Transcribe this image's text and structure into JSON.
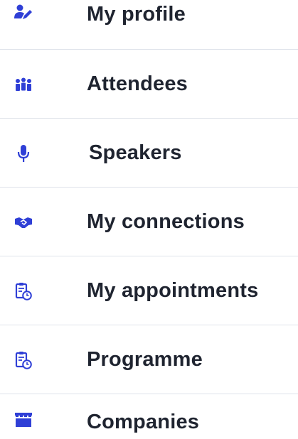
{
  "menu": {
    "items": [
      {
        "label": "My profile",
        "icon": "user-edit-icon"
      },
      {
        "label": "Attendees",
        "icon": "users-group-icon"
      },
      {
        "label": "Speakers",
        "icon": "microphone-icon"
      },
      {
        "label": "My connections",
        "icon": "handshake-icon"
      },
      {
        "label": "My appointments",
        "icon": "clipboard-clock-icon"
      },
      {
        "label": "Programme",
        "icon": "clipboard-clock-icon"
      },
      {
        "label": "Companies",
        "icon": "storefront-icon"
      }
    ]
  },
  "colors": {
    "icon": "#2f3fd6",
    "text": "#1f2430",
    "divider": "#dfe3ea"
  }
}
